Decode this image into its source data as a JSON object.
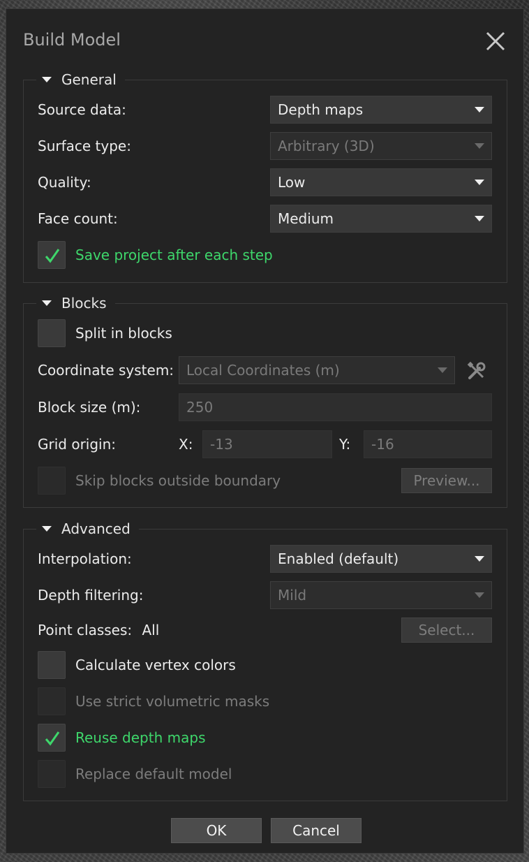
{
  "dialog": {
    "title": "Build Model"
  },
  "general": {
    "heading": "General",
    "source_label": "Source data:",
    "source_value": "Depth maps",
    "surface_label": "Surface type:",
    "surface_value": "Arbitrary (3D)",
    "quality_label": "Quality:",
    "quality_value": "Low",
    "face_label": "Face count:",
    "face_value": "Medium",
    "save_label": "Save project after each step",
    "save_checked": true
  },
  "blocks": {
    "heading": "Blocks",
    "split_label": "Split in blocks",
    "split_checked": false,
    "coord_label": "Coordinate system:",
    "coord_value": "Local Coordinates (m)",
    "size_label": "Block size (m):",
    "size_value": "250",
    "grid_label": "Grid origin:",
    "x_label": "X:",
    "x_value": "-13",
    "y_label": "Y:",
    "y_value": "-16",
    "skip_label": "Skip blocks outside boundary",
    "preview_button": "Preview..."
  },
  "advanced": {
    "heading": "Advanced",
    "interp_label": "Interpolation:",
    "interp_value": "Enabled (default)",
    "filter_label": "Depth filtering:",
    "filter_value": "Mild",
    "classes_label": "Point classes:",
    "classes_value": "All",
    "select_button": "Select...",
    "vertex_label": "Calculate vertex colors",
    "strict_label": "Use strict volumetric masks",
    "reuse_label": "Reuse depth maps",
    "replace_label": "Replace default model"
  },
  "footer": {
    "ok": "OK",
    "cancel": "Cancel"
  },
  "colors": {
    "accent_check": "#3ed76b",
    "dialog_bg": "#232323"
  }
}
